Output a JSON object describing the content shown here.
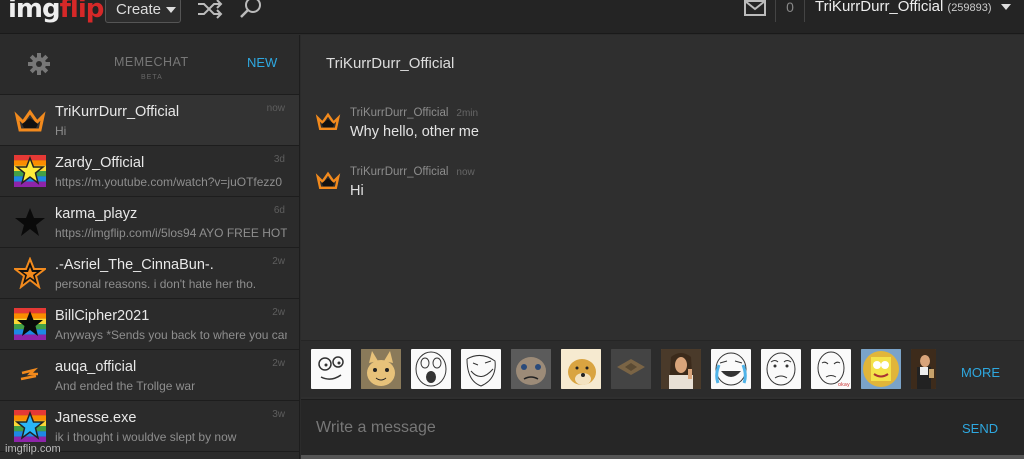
{
  "navbar": {
    "logo_main": "img",
    "logo_flip": "flip",
    "create_label": "Create",
    "notif_count": "0",
    "username": "TriKurrDurr_Official",
    "points": "(259893)"
  },
  "sidebar": {
    "title": "MEMECHAT",
    "beta": "BETA",
    "new_label": "NEW",
    "conversations": [
      {
        "name": "TriKurrDurr_Official",
        "preview": "Hi",
        "time": "now",
        "avatar": "orange-crown-icon"
      },
      {
        "name": "Zardy_Official",
        "preview": "https://m.youtube.com/watch?v=juOTfezz0",
        "time": "3d",
        "avatar": "rainbow-yellow-star-icon"
      },
      {
        "name": "karma_playz",
        "preview": "https://imgflip.com/i/5los94 AYO FREE HOT",
        "time": "6d",
        "avatar": "black-star-icon"
      },
      {
        "name": ".-Asriel_The_CinnaBun-.",
        "preview": "personal reasons. i don't hate her tho.",
        "time": "2w",
        "avatar": "orange-outline-star-icon"
      },
      {
        "name": "BillCipher2021",
        "preview": "Anyways *Sends you back to where you came",
        "time": "2w",
        "avatar": "rainbow-black-star-icon"
      },
      {
        "name": "auqa_official",
        "preview": "And ended the Trollge war",
        "time": "2w",
        "avatar": "orange-dash-icon"
      },
      {
        "name": "Janesse.exe",
        "preview": "ik i thought i wouldve slept by now",
        "time": "3w",
        "avatar": "rainbow-blue-star-icon"
      }
    ]
  },
  "chat": {
    "title": "TriKurrDurr_Official",
    "messages": [
      {
        "author": "TriKurrDurr_Official",
        "time": "2min",
        "text": "Why hello, other me"
      },
      {
        "author": "TriKurrDurr_Official",
        "time": "now",
        "text": "Hi"
      }
    ],
    "more_label": "MORE",
    "input_placeholder": "Write a message",
    "send_label": "SEND",
    "meme_thumbs": [
      "derp-face",
      "happy-cat",
      "surprised-face",
      "troll-smile",
      "grumpy-cat",
      "doge",
      "scumbag-hat",
      "jesus",
      "tears-of-joy-face",
      "okay-face",
      "sad-okay-face",
      "spongebob-imagination",
      "leonardo-dicaprio"
    ]
  },
  "watermark": "imgflip.com",
  "colors": {
    "accent": "#2ea8e0",
    "brand": "#d62828",
    "crown": "#f28a1d"
  }
}
